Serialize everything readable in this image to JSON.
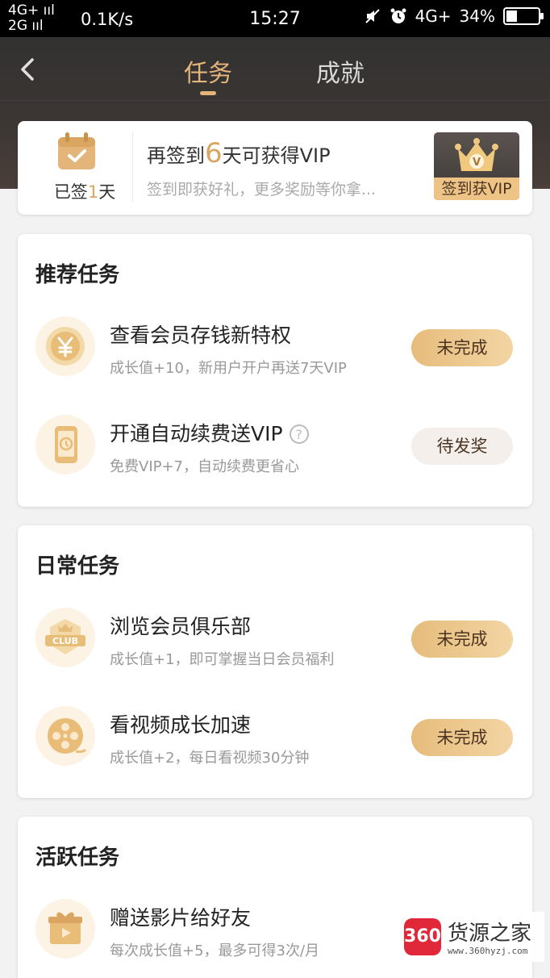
{
  "status_bar": {
    "signal_top": "4G+ ııl",
    "signal_bottom": "2G ııl",
    "speed": "0.1K/s",
    "time": "15:27",
    "network_right": "4G+",
    "battery": "34%",
    "battery_level": 0.34
  },
  "header": {
    "tabs": [
      {
        "label": "任务",
        "active": true
      },
      {
        "label": "成就",
        "active": false
      }
    ]
  },
  "signin": {
    "signed_prefix": "已签",
    "signed_count": "1",
    "signed_suffix": "天",
    "title_prefix": "再签到",
    "title_days": "6",
    "title_suffix": "天可获得VIP",
    "subtitle": "签到即获好礼，更多奖励等你拿...",
    "vip_button": "签到获VIP",
    "vip_letter": "V"
  },
  "sections": [
    {
      "title": "推荐任务",
      "tasks": [
        {
          "title": "查看会员存钱新特权",
          "subtitle": "成长值+10，新用户开户再送7天VIP",
          "button": "未完成",
          "icon": "yen-coin-icon"
        },
        {
          "title": "开通自动续费送VIP",
          "subtitle": "免费VIP+7，自动续费更省心",
          "button": "待发奖",
          "icon": "phone-renew-icon",
          "help": "?"
        }
      ]
    },
    {
      "title": "日常任务",
      "tasks": [
        {
          "title": "浏览会员俱乐部",
          "subtitle": "成长值+1，即可掌握当日会员福利",
          "button": "未完成",
          "icon": "club-badge-icon",
          "badge_text": "CLUB"
        },
        {
          "title": "看视频成长加速",
          "subtitle": "成长值+2，每日看视频30分钟",
          "button": "未完成",
          "icon": "film-reel-icon"
        }
      ]
    },
    {
      "title": "活跃任务",
      "tasks": [
        {
          "title": "赠送影片给好友",
          "subtitle": "每次成长值+5，最多可得3次/月",
          "icon": "gift-video-icon"
        }
      ]
    }
  ],
  "watermark": {
    "logo": "360",
    "name": "货源之家",
    "url": "www.360hyzj.com"
  },
  "colors": {
    "accent_gold": "#e3b57b",
    "header_dark": "#333131",
    "button_gold": "#e6bc7c"
  }
}
